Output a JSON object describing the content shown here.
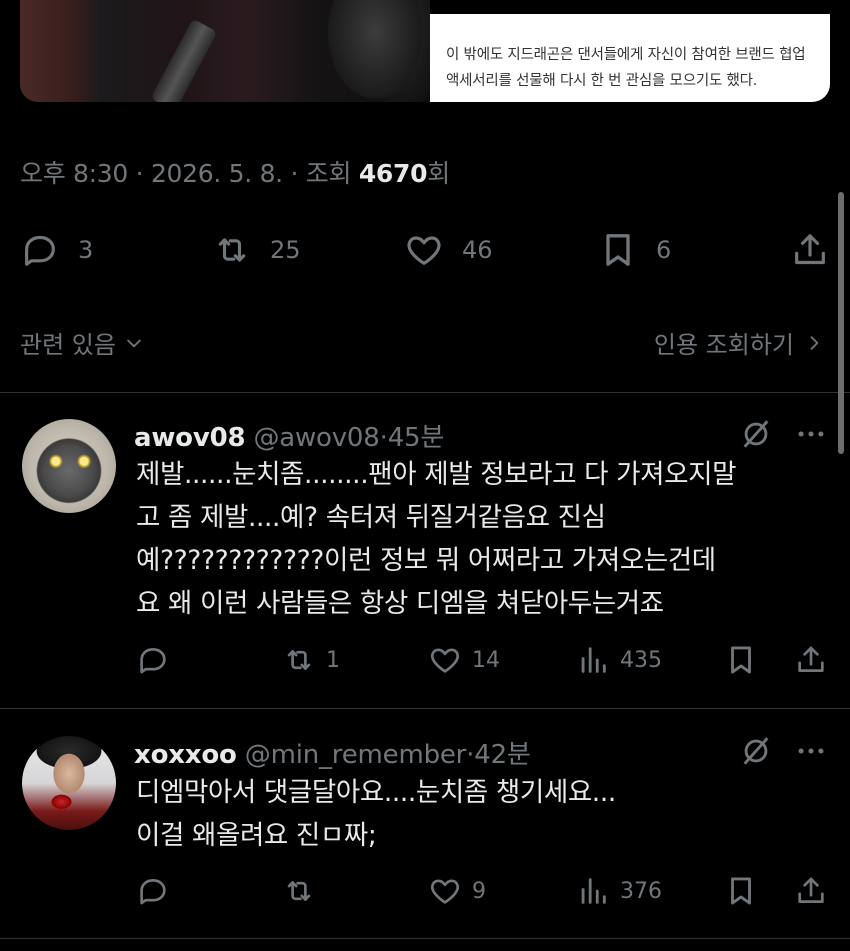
{
  "media": {
    "card_text": "이 밖에도 지드래곤은 댄서들에게 자신이 참여한 브랜드 협업 액세서리를 선물해 다시 한 번 관심을 모으기도 했다."
  },
  "tweet_meta": {
    "time": "오후 8:30",
    "sep1": " · ",
    "date": "2026. 5. 8.",
    "sep2": " · 조회 ",
    "views": "4670",
    "views_suffix": "회"
  },
  "actions": {
    "replies": "3",
    "retweets": "25",
    "likes": "46",
    "bookmarks": "6"
  },
  "related": {
    "left_label": "관련 있음",
    "right_label": "인용 조회하기"
  },
  "replies": [
    {
      "name": "awov08",
      "handle": "@awov08",
      "time": "·45분",
      "text_lines": [
        "제발......눈치좀........팬아 제발 정보라고 다 가져오지말",
        "고 좀 제발....예? 속터져 뒤질거같음요 진심",
        "예????????????이런 정보 뭐 어쩌라고 가져오는건데",
        "요 왜 이런 사람들은 항상 디엠을 쳐닫아두는거죠"
      ],
      "replies_count": "",
      "retweets": "1",
      "likes": "14",
      "views": "435"
    },
    {
      "name": "xoxxoo",
      "handle": "@min_remember",
      "time": "·42분",
      "text_lines": [
        "디엠막아서 댓글달아요....눈치좀 챙기세요...",
        "이걸 왜올려요 진ㅁ짜;"
      ],
      "replies_count": "",
      "retweets": "",
      "likes": "9",
      "views": "376"
    }
  ],
  "colors": {
    "background": "#000000",
    "text": "#e7e9ea",
    "muted": "#71767b",
    "divider": "#2f3336"
  },
  "icons": [
    "comment-icon",
    "retweet-icon",
    "heart-icon",
    "bookmark-icon",
    "share-icon",
    "chevron-down-icon",
    "chevron-right-icon",
    "grok-icon",
    "more-icon",
    "analytics-icon"
  ]
}
